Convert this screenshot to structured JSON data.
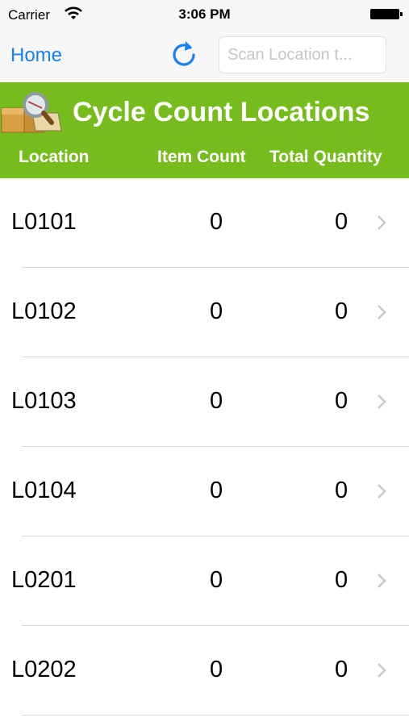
{
  "status_bar": {
    "carrier": "Carrier",
    "time": "3:06 PM"
  },
  "nav": {
    "home_label": "Home",
    "search_placeholder": "Scan Location t...",
    "accent_color": "#1a7ef5"
  },
  "header": {
    "title": "Cycle Count Locations",
    "columns": {
      "location": "Location",
      "item_count": "Item Count",
      "total_quantity": "Total Quantity"
    },
    "background_color": "#76bc1c"
  },
  "rows": [
    {
      "location": "L0101",
      "item_count": "0",
      "total_quantity": "0"
    },
    {
      "location": "L0102",
      "item_count": "0",
      "total_quantity": "0"
    },
    {
      "location": "L0103",
      "item_count": "0",
      "total_quantity": "0"
    },
    {
      "location": "L0104",
      "item_count": "0",
      "total_quantity": "0"
    },
    {
      "location": "L0201",
      "item_count": "0",
      "total_quantity": "0"
    },
    {
      "location": "L0202",
      "item_count": "0",
      "total_quantity": "0"
    }
  ]
}
